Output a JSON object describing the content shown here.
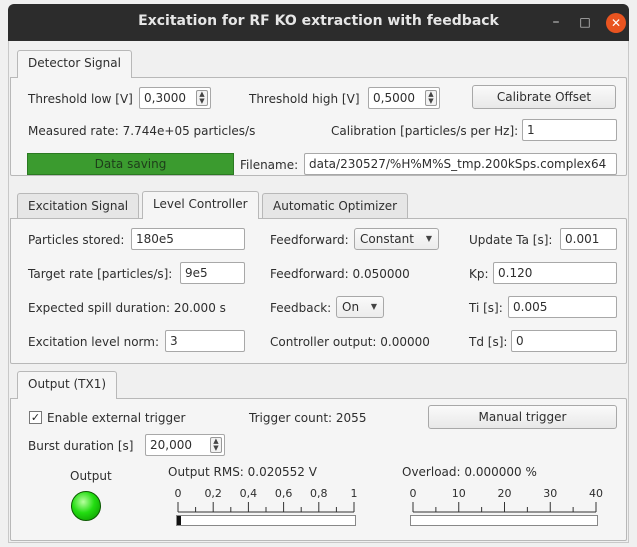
{
  "window": {
    "title": "Excitation for RF KO extraction with feedback",
    "minimize_glyph": "–",
    "maximize_glyph": "□",
    "close_glyph": "✕"
  },
  "detector": {
    "tab_label": "Detector Signal",
    "threshold_low_label": "Threshold low [V]",
    "threshold_low_value": "0,3000",
    "threshold_high_label": "Threshold high [V]",
    "threshold_high_value": "0,5000",
    "calibrate_button": "Calibrate Offset",
    "measured_rate_text": "Measured rate: 7.744e+05 particles/s",
    "calibration_label": "Calibration [particles/s per Hz]:",
    "calibration_value": "1",
    "data_saving_label": "Data saving",
    "filename_label": "Filename:",
    "filename_value": "data/230527/%H%M%S_tmp.200kSps.complex64"
  },
  "controller_tabs": {
    "tabs": [
      "Excitation Signal",
      "Level Controller",
      "Automatic Optimizer"
    ],
    "active_tab": "Level Controller"
  },
  "level_controller": {
    "particles_stored_label": "Particles stored:",
    "particles_stored_value": "180e5",
    "target_rate_label": "Target rate [particles/s]:",
    "target_rate_value": "9e5",
    "expected_spill_text": "Expected spill duration:  20.000 s",
    "excitation_norm_label": "Excitation level norm:",
    "excitation_norm_value": "3",
    "feedforward_label": "Feedforward:",
    "feedforward_mode": "Constant",
    "feedforward_value_text": "Feedforward:  0.050000",
    "feedback_label": "Feedback:",
    "feedback_mode": "On",
    "controller_output_text": "Controller output:  0.00000",
    "update_ta_label": "Update Ta [s]:",
    "update_ta_value": "0.001",
    "kp_label": "Kp:",
    "kp_value": "0.120",
    "ti_label": "Ti [s]:",
    "ti_value": "0.005",
    "td_label": "Td [s]:",
    "td_value": "0"
  },
  "output": {
    "tab_label": "Output (TX1)",
    "enable_trigger_label": "Enable external trigger",
    "enable_trigger_checked": true,
    "check_glyph": "✓",
    "trigger_count_text": "Trigger count: 2055",
    "manual_trigger_button": "Manual trigger",
    "burst_duration_label": "Burst duration [s]",
    "burst_duration_value": "20,000",
    "output_led_label": "Output",
    "output_led_color": "#22dd11",
    "rms_text": "Output RMS: 0.020552 V",
    "rms_ticks": [
      "0",
      "0,2",
      "0,4",
      "0,6",
      "0,8",
      "1"
    ],
    "rms_level_fraction": 0.02,
    "overload_text": "Overload: 0.000000 %",
    "overload_ticks": [
      "0",
      "10",
      "20",
      "30",
      "40"
    ],
    "overload_level_fraction": 0.0
  }
}
